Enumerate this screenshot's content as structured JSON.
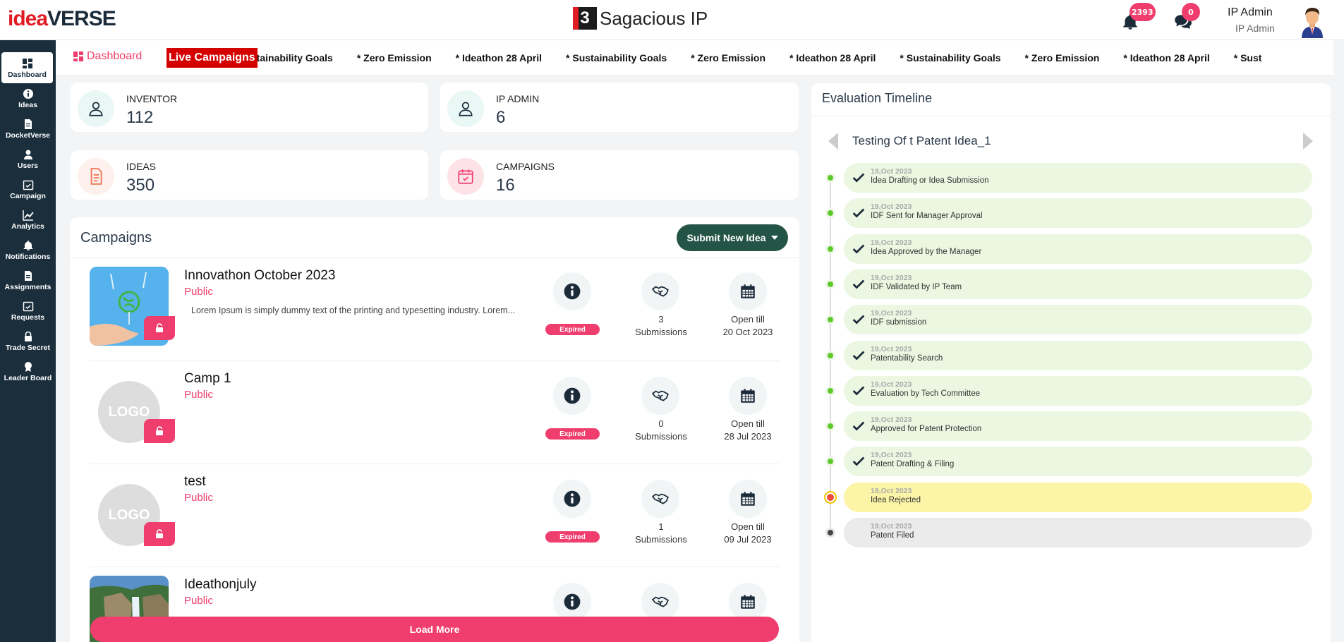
{
  "header": {
    "logo_idea": "idea",
    "logo_verse": "VERSE",
    "brand_mark": "3",
    "brand_name": "Sagacious IP",
    "notifications_count": "2393",
    "messages_count": "0",
    "user_name": "IP Admin",
    "user_role": "IP Admin"
  },
  "sidebar": {
    "items": [
      {
        "label": "Dashboard",
        "icon": "dashboard-icon"
      },
      {
        "label": "Ideas",
        "icon": "info-icon"
      },
      {
        "label": "DocketVerse",
        "icon": "document-icon"
      },
      {
        "label": "Users",
        "icon": "user-icon"
      },
      {
        "label": "Campaign",
        "icon": "calendar-check-icon"
      },
      {
        "label": "Analytics",
        "icon": "chart-icon"
      },
      {
        "label": "Notifications",
        "icon": "bell-icon"
      },
      {
        "label": "Assignments",
        "icon": "document-icon"
      },
      {
        "label": "Requests",
        "icon": "calendar-check-icon"
      },
      {
        "label": "Trade Secret",
        "icon": "lock-icon"
      },
      {
        "label": "Leader Board",
        "icon": "award-icon"
      }
    ]
  },
  "ticker": {
    "dashboard_label": "Dashboard",
    "live_label": "Live Campaigns",
    "items": [
      "Sustainability Goals",
      "* Zero Emission",
      "* Ideathon 28 April",
      "* Sustainability Goals",
      "* Zero Emission",
      "* Ideathon 28 April",
      "* Sustainability Goals",
      "* Zero Emission",
      "* Ideathon 28 April",
      "* Sustainability Goals"
    ]
  },
  "stats": {
    "inventor": {
      "label": "INVENTOR",
      "value": "112"
    },
    "ip_admin": {
      "label": "IP ADMIN",
      "value": "6"
    },
    "ideas": {
      "label": "IDEAS",
      "value": "350"
    },
    "campaigns": {
      "label": "CAMPAIGNS",
      "value": "16"
    }
  },
  "campaigns": {
    "title": "Campaigns",
    "submit_label": "Submit New Idea",
    "load_more": "Load More",
    "rows": [
      {
        "name": "Innovathon October 2023",
        "visibility": "Public",
        "description": "Lorem Ipsum is simply dummy text of the printing and typesetting industry. Lorem...",
        "status": "Expired",
        "submissions": "3",
        "submissions_label": "Submissions",
        "open_label": "Open till",
        "open_date": "20 Oct 2023"
      },
      {
        "name": "Camp 1",
        "visibility": "Public",
        "logo": "LOGO",
        "description": "",
        "status": "Expired",
        "submissions": "0",
        "submissions_label": "Submissions",
        "open_label": "Open till",
        "open_date": "28 Jul 2023"
      },
      {
        "name": "test",
        "visibility": "Public",
        "logo": "LOGO",
        "description": "",
        "status": "Expired",
        "submissions": "1",
        "submissions_label": "Submissions",
        "open_label": "Open till",
        "open_date": "09 Jul 2023"
      },
      {
        "name": "Ideathonjuly",
        "visibility": "Public",
        "description": ""
      }
    ]
  },
  "timeline": {
    "title": "Evaluation Timeline",
    "idea_name": "Testing Of t Patent Idea_1",
    "steps": [
      {
        "date": "19,Oct 2023",
        "label": "Idea Drafting or Idea Submission",
        "state": "done"
      },
      {
        "date": "19,Oct 2023",
        "label": "IDF Sent for Manager Approval",
        "state": "done"
      },
      {
        "date": "19,Oct 2023",
        "label": "Idea Approved by the Manager",
        "state": "done"
      },
      {
        "date": "19,Oct 2023",
        "label": "IDF Validated by IP Team",
        "state": "done"
      },
      {
        "date": "19,Oct 2023",
        "label": "IDF submission",
        "state": "done"
      },
      {
        "date": "19,Oct 2023",
        "label": "Patentability Search",
        "state": "done"
      },
      {
        "date": "19,Oct 2023",
        "label": "Evaluation by Tech Committee",
        "state": "done"
      },
      {
        "date": "19,Oct 2023",
        "label": "Approved for Patent Protection",
        "state": "done"
      },
      {
        "date": "19,Oct 2023",
        "label": "Patent Drafting & Filing",
        "state": "done"
      },
      {
        "date": "19,Oct 2023",
        "label": "Idea Rejected",
        "state": "rejected"
      },
      {
        "date": "19,Oct 2023",
        "label": "Patent Filed",
        "state": "pending"
      }
    ]
  },
  "colors": {
    "accent_pink": "#ef3e6d",
    "sidebar_bg": "#1a2e3b",
    "submit_green": "#245446",
    "step_done": "#ebf7e1",
    "step_rejected": "#fcf5a8",
    "step_pending": "#ebebeb",
    "live_red": "#d40000"
  }
}
